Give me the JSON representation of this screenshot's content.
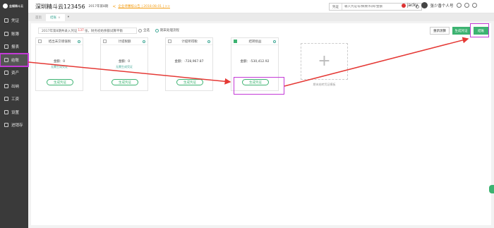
{
  "app": {
    "logo_text": "金蝶精斗云",
    "company": "深圳精斗云123456",
    "period": "2017年第8期",
    "notice": "企业待審核公告 | 2018.08.01 | >>"
  },
  "search": {
    "type": "凭证",
    "placeholder": "输入凭证号/摘要/科目/金额"
  },
  "user": {
    "name": "jacky",
    "account": "张少香个人号"
  },
  "sidebar": {
    "items": [
      {
        "label": "凭证"
      },
      {
        "label": "账簿"
      },
      {
        "label": "报表"
      },
      {
        "label": "结账"
      },
      {
        "label": "资产"
      },
      {
        "label": "出纳"
      },
      {
        "label": "工资"
      },
      {
        "label": "设置"
      },
      {
        "label": "进销存"
      }
    ]
  },
  "tabs": {
    "home": "首页",
    "active": "结账",
    "close": "×",
    "dropdown": "▾"
  },
  "toolbar": {
    "info_prefix": "2017年第8期共录入凭证",
    "info_count": "137",
    "info_suffix": "张，财务初始余额试算平衡",
    "check_all": "全选",
    "flow_check": "期末处理流程",
    "reset": "重新测算",
    "generate": "生成凭证",
    "close": "结账"
  },
  "cards": [
    {
      "title": "结出未交增值税",
      "amount": "金额：0",
      "note": "无需生成凭证",
      "button": "生成凭证",
      "checked": false
    },
    {
      "title": "计提税额",
      "amount": "金额：0",
      "note": "无需生成凭证",
      "button": "生成凭证",
      "checked": false
    },
    {
      "title": "计提所得税",
      "amount": "金额：-728,967.87",
      "note": "",
      "button": "生成凭证",
      "checked": false
    },
    {
      "title": "结转损益",
      "amount": "金额：-530,412.92",
      "note": "",
      "button": "生成凭证",
      "checked": true
    }
  ],
  "add_card_label": "期末结转凭证模板"
}
